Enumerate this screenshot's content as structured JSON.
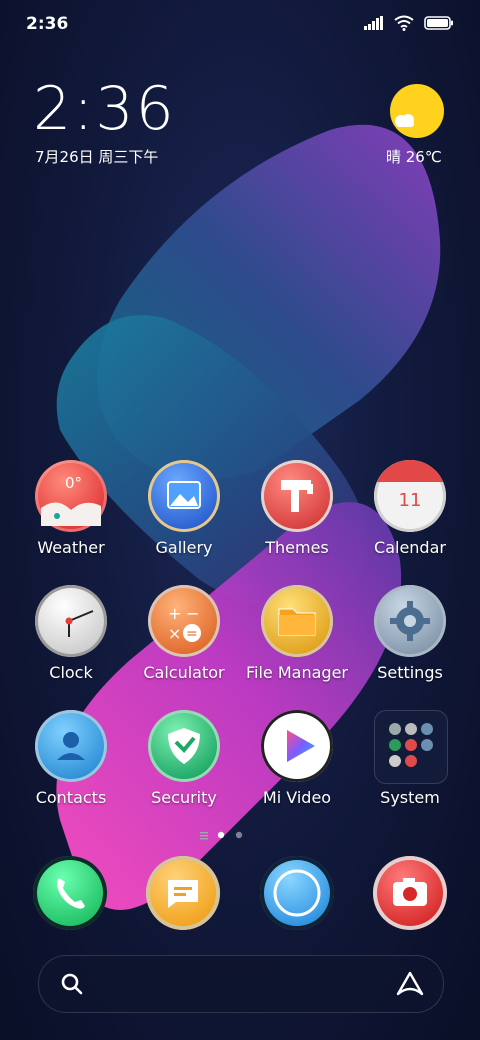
{
  "status_bar": {
    "time": "2:36"
  },
  "clock_widget": {
    "time": "2:36",
    "date": "7月26日 周三下午"
  },
  "weather_widget": {
    "condition_temp": "晴 26℃",
    "icon": "sun-cloud-icon"
  },
  "weather_app_icon": {
    "temp": "0°"
  },
  "calendar_app_icon": {
    "day": "11"
  },
  "apps": [
    {
      "label": "Weather",
      "icon": "weather-icon"
    },
    {
      "label": "Gallery",
      "icon": "gallery-icon"
    },
    {
      "label": "Themes",
      "icon": "themes-icon"
    },
    {
      "label": "Calendar",
      "icon": "calendar-icon"
    },
    {
      "label": "Clock",
      "icon": "clock-icon"
    },
    {
      "label": "Calculator",
      "icon": "calculator-icon"
    },
    {
      "label": "File Manager",
      "icon": "folder-icon"
    },
    {
      "label": "Settings",
      "icon": "gear-icon"
    },
    {
      "label": "Contacts",
      "icon": "contacts-icon"
    },
    {
      "label": "Security",
      "icon": "shield-icon"
    },
    {
      "label": "Mi Video",
      "icon": "play-icon"
    },
    {
      "label": "System",
      "icon": "folder-grid-icon"
    }
  ],
  "dock": [
    {
      "icon": "phone-icon"
    },
    {
      "icon": "messages-icon"
    },
    {
      "icon": "browser-icon"
    },
    {
      "icon": "camera-icon"
    }
  ],
  "page_indicator": {
    "pages": 2,
    "current": 1
  },
  "colors": {
    "accent_pink": "#ff4fc4",
    "accent_purple": "#8a3fc0",
    "accent_teal": "#2a8fa8",
    "sun": "#ffd21e"
  }
}
